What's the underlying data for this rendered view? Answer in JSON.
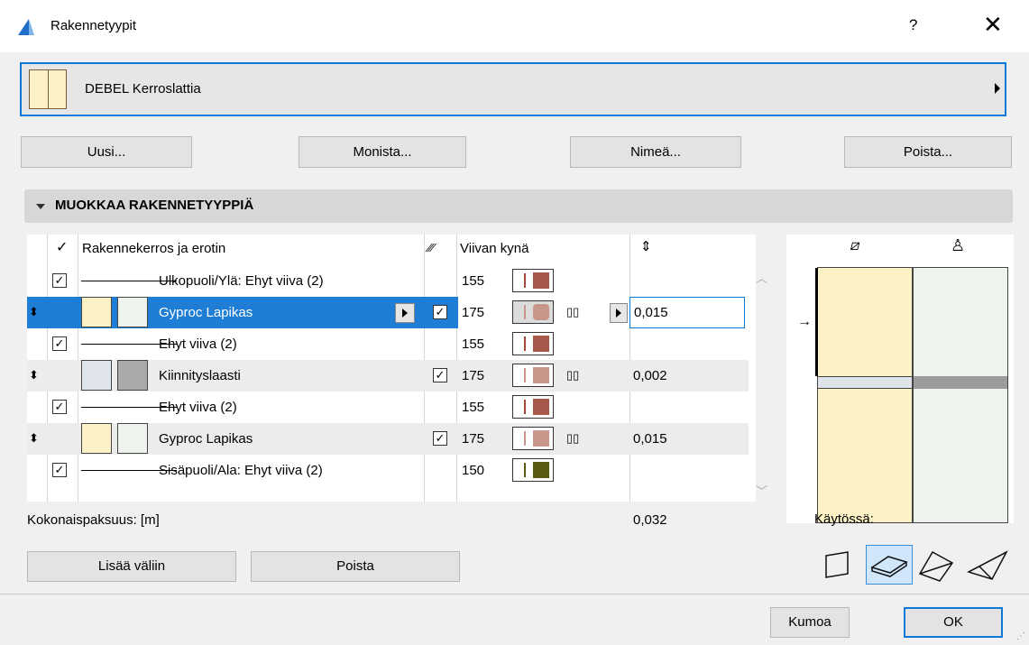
{
  "window": {
    "title": "Rakennetyypit",
    "help_label": "?",
    "close_label": "✕"
  },
  "type_selector": {
    "name": "DEBEL Kerroslattia"
  },
  "top_buttons": {
    "new": "Uusi...",
    "duplicate": "Monista...",
    "rename": "Nimeä...",
    "delete": "Poista..."
  },
  "section": {
    "title": "MUOKKAA RAKENNETYYPPIÄ"
  },
  "columns": {
    "layer": "Rakennekerros ja erotin",
    "pen": "Viivan kynä"
  },
  "rows": [
    {
      "type": "line",
      "label": "Ulkopuoli/Ylä: Ehyt viiva (2)",
      "pen": "155",
      "color": "#a8584a"
    },
    {
      "type": "layer",
      "label": "Gyproc Lapikas",
      "pen": "175",
      "thickness": "0,015",
      "selected": true
    },
    {
      "type": "line",
      "label": "Ehyt viiva (2)",
      "pen": "155",
      "color": "#a8584a"
    },
    {
      "type": "layer",
      "label": "Kiinnityslaasti",
      "pen": "175",
      "thickness": "0,002"
    },
    {
      "type": "line",
      "label": "Ehyt viiva (2)",
      "pen": "155",
      "color": "#a8584a"
    },
    {
      "type": "layer",
      "label": "Gyproc Lapikas",
      "pen": "175",
      "thickness": "0,015"
    },
    {
      "type": "line",
      "label": "Sisäpuoli/Ala: Ehyt viiva (2)",
      "pen": "150",
      "color": "#5a5a12"
    }
  ],
  "total": {
    "label": "Kokonaispaksuus: [m]",
    "value": "0,032"
  },
  "in_use": {
    "label": "Käytössä:"
  },
  "bottom_buttons": {
    "insert": "Lisää väliin",
    "remove": "Poista"
  },
  "dialog_buttons": {
    "cancel": "Kumoa",
    "ok": "OK"
  },
  "colors": {
    "accent": "#1e7ed6",
    "pen_brown": "#a8584a",
    "pen_olive": "#5a5a12",
    "fill_yellow": "#fdf2c5"
  }
}
